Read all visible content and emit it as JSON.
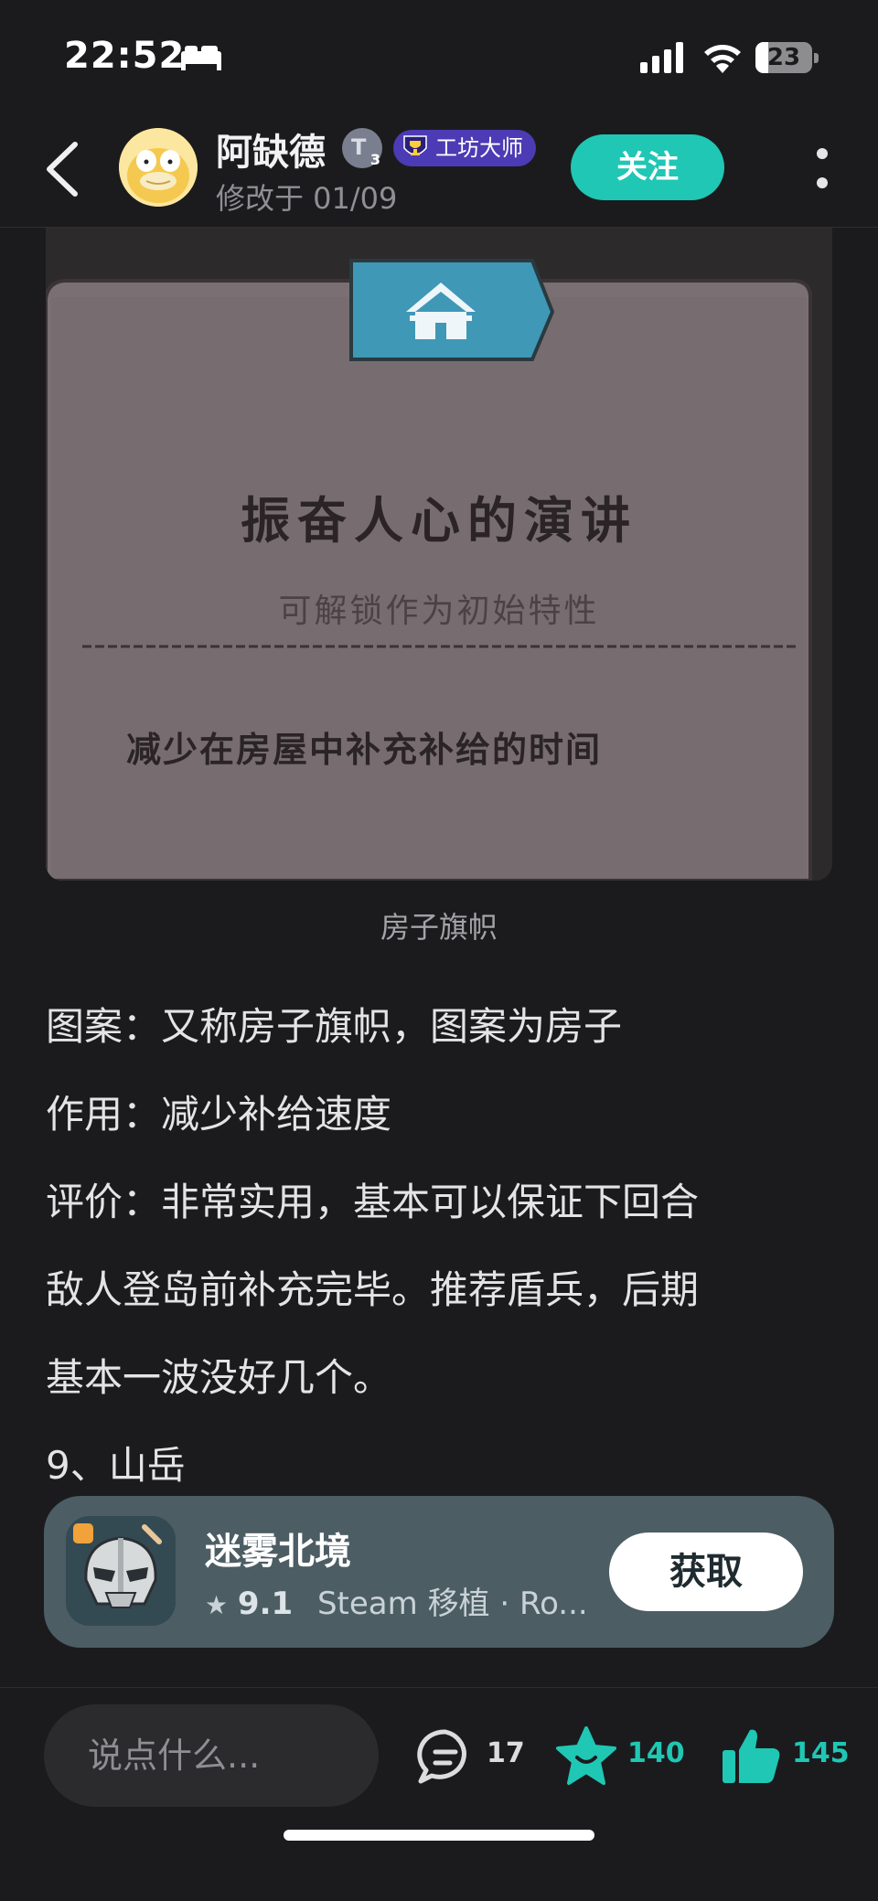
{
  "status_bar": {
    "time": "22:52",
    "battery_level": "23",
    "icons": [
      "bed-icon",
      "cellular-signal-icon",
      "wifi-icon",
      "battery-icon"
    ]
  },
  "header": {
    "author_name": "阿缺德",
    "level_badge": "3",
    "title_badge": "工坊大师",
    "edit_time": "修改于 01/09",
    "follow_label": "关注"
  },
  "image": {
    "heading": "振奋人心的演讲",
    "subtitle": "可解锁作为初始特性",
    "description": "减少在房屋中补充补给的时间",
    "caption": "房子旗帜"
  },
  "article": {
    "line1": "图案：又称房子旗帜，图案为房子",
    "line2": "作用：减少补给速度",
    "line3": "评价：非常实用，基本可以保证下回合",
    "line4": "敌人登岛前补充完毕。推荐盾兵，后期",
    "line5": "基本一波没好几个。",
    "line6": "9、山岳"
  },
  "game_card": {
    "title": "迷雾北境",
    "rating": "9.1",
    "meta": "Steam 移植 · Ro...",
    "get_label": "获取"
  },
  "bottom_bar": {
    "comment_placeholder": "说点什么...",
    "comment_count": "17",
    "favorite_count": "140",
    "like_count": "145"
  },
  "colors": {
    "accent": "#1fc7b4",
    "background": "#1b1b1d",
    "badge_purple": "#4b3bb4",
    "card_bg": "#4c5d64"
  }
}
